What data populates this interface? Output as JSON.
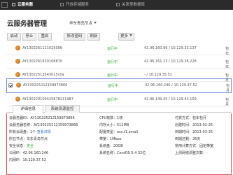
{
  "topbar": {
    "tabs": [
      {
        "label": "云服务器",
        "icon": "server-icon"
      },
      {
        "label": "开放存储服务",
        "icon": "storage-icon"
      },
      {
        "label": "关系型数据库",
        "icon": "database-icon"
      }
    ]
  },
  "header": {
    "title": "云服务器管理",
    "region": "华东青岛节点"
  },
  "toolbar": {
    "buttons": [
      "启动",
      "停止",
      "重启",
      "修改密码",
      "刷新",
      "更多"
    ]
  },
  "instances": [
    {
      "id": "AY1302261121025006",
      "status": "运行中",
      "ip": "42.96.160.99 / 10.129.33.137",
      "billing": "包年",
      "selected": false
    },
    {
      "id": "AY1302261630108870",
      "status": "运行中",
      "ip": "42.96.161.23 / 10.129.38.228",
      "billing": "包年",
      "selected": false
    },
    {
      "id": "AY13022513543015c0a",
      "status": "运行中",
      "ip": "- / 10.129.35.51",
      "billing": "包月",
      "selected": false
    },
    {
      "id": "AY130225212159973866",
      "status": "运行中",
      "ip": "42.96.160.246 / 10.129.37.52",
      "billing": "包月",
      "selected": true
    },
    {
      "id": "AY130220109425878211987",
      "status": "运行中",
      "ip": "42.96.149.45 / 10.129.43.159",
      "billing": "包月",
      "selected": false
    }
  ],
  "detail_tabs": [
    "详细信息",
    "系统资源监控"
  ],
  "details": {
    "c1": [
      "云服务器ID：AY130225212159973866",
      "云服务器名称：AY130225212159973866",
      "所有云硬盘：1个",
      "所在节点：华东青岛节点",
      "安全状态：安全",
      "公网IP：42.96.160.246",
      "内网IP：10.129.37.52"
    ],
    "hardware_link": "查看详情",
    "c2": [
      "CPU核数：1核",
      "内存大小：512MB",
      "配置类型：ecs.t1.small",
      "带宽：1Mbps",
      "系统盘：20GB",
      "系统名称：CentOS 5.4 32位"
    ],
    "c3": [
      "付费方式：包年包月",
      "创建时间：2013-02-25",
      "到期时间：2013-03-25",
      "到期还剩：26天",
      "常用计算方式：固定带宽",
      "上周网络调整次数：-"
    ]
  }
}
